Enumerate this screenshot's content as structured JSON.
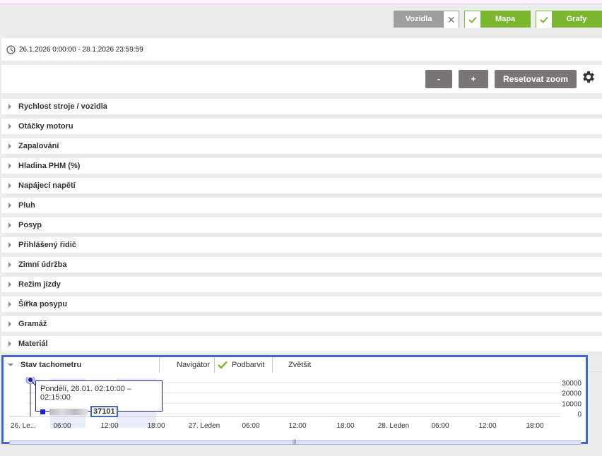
{
  "toolbar": {
    "vozidla_label": "Vozidla",
    "vozidla_icon": "close-icon",
    "mapa_label": "Mapa",
    "grafy_label": "Grafy",
    "accent_color": "#7cb82f",
    "inactive_color": "#9e9e9e"
  },
  "date_range": {
    "text": "26.1.2026 0:00:00 - 28.1.2026 23:59:59",
    "icon": "clock-icon"
  },
  "zoom": {
    "minus_label": "-",
    "plus_label": "+",
    "reset_label": "Resetovat zoom",
    "settings_icon": "gear-icon"
  },
  "sections": [
    "Rychlost stroje / vozidla",
    "Otáčky motoru",
    "Zapalování",
    "Hladina PHM (%)",
    "Napájecí napětí",
    "Pluh",
    "Posyp",
    "Přihlášený řidič",
    "Zimní údržba",
    "Režim jízdy",
    "Šířka posypu",
    "Gramáž",
    "Materiál"
  ],
  "chart": {
    "title": "Stav tachometru",
    "options": {
      "navigator": "Navigátor",
      "podbarvit": "Podbarvit",
      "zvetsit": "Zvětšit"
    },
    "tooltip": {
      "date": "Pondělí, 26.01. 02:10:00 – 02:15:00",
      "value": "37101"
    },
    "highlight_color": "#3f66d6"
  },
  "chart_data": {
    "type": "line",
    "title": "Stav tachometru",
    "y_ticks": [
      "30000",
      "20000",
      "10000",
      "0"
    ],
    "ylim": [
      0,
      30000
    ],
    "x_ticks": [
      "26. Le...",
      "06:00",
      "12:00",
      "18:00",
      "27. Leden",
      "06:00",
      "12:00",
      "18:00",
      "28. Leden",
      "06:00",
      "12:00",
      "18:00"
    ],
    "series": [
      {
        "x": [
          "26.01. 02:10"
        ],
        "values": [
          37101
        ]
      }
    ],
    "grid": true
  }
}
